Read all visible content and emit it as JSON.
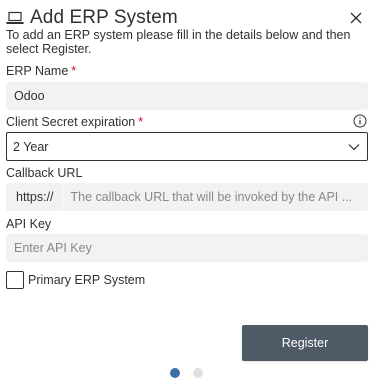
{
  "header": {
    "title": "Add ERP System",
    "icon": "laptop-icon"
  },
  "description": "To add an ERP system please fill in the details below and then select Register.",
  "erp_name": {
    "label": "ERP Name",
    "required": "*",
    "value": "Odoo"
  },
  "client_secret": {
    "label": "Client Secret expiration",
    "required": "*",
    "selected": "2 Year"
  },
  "callback_url": {
    "label": "Callback URL",
    "prefix": "https://",
    "placeholder": "The callback URL that will be invoked by the API ..."
  },
  "api_key": {
    "label": "API Key",
    "placeholder": "Enter API Key"
  },
  "primary": {
    "label": "Primary ERP System"
  },
  "actions": {
    "register_label": "Register"
  },
  "pagination": {
    "current_page": 1,
    "total_pages": 2
  },
  "colors": {
    "required": "#c50f1f",
    "button": "#4e5a66",
    "field_background": "#f3f2f1",
    "dot_active": "#3a6ea5",
    "dot_inactive": "#e1dfdd"
  }
}
